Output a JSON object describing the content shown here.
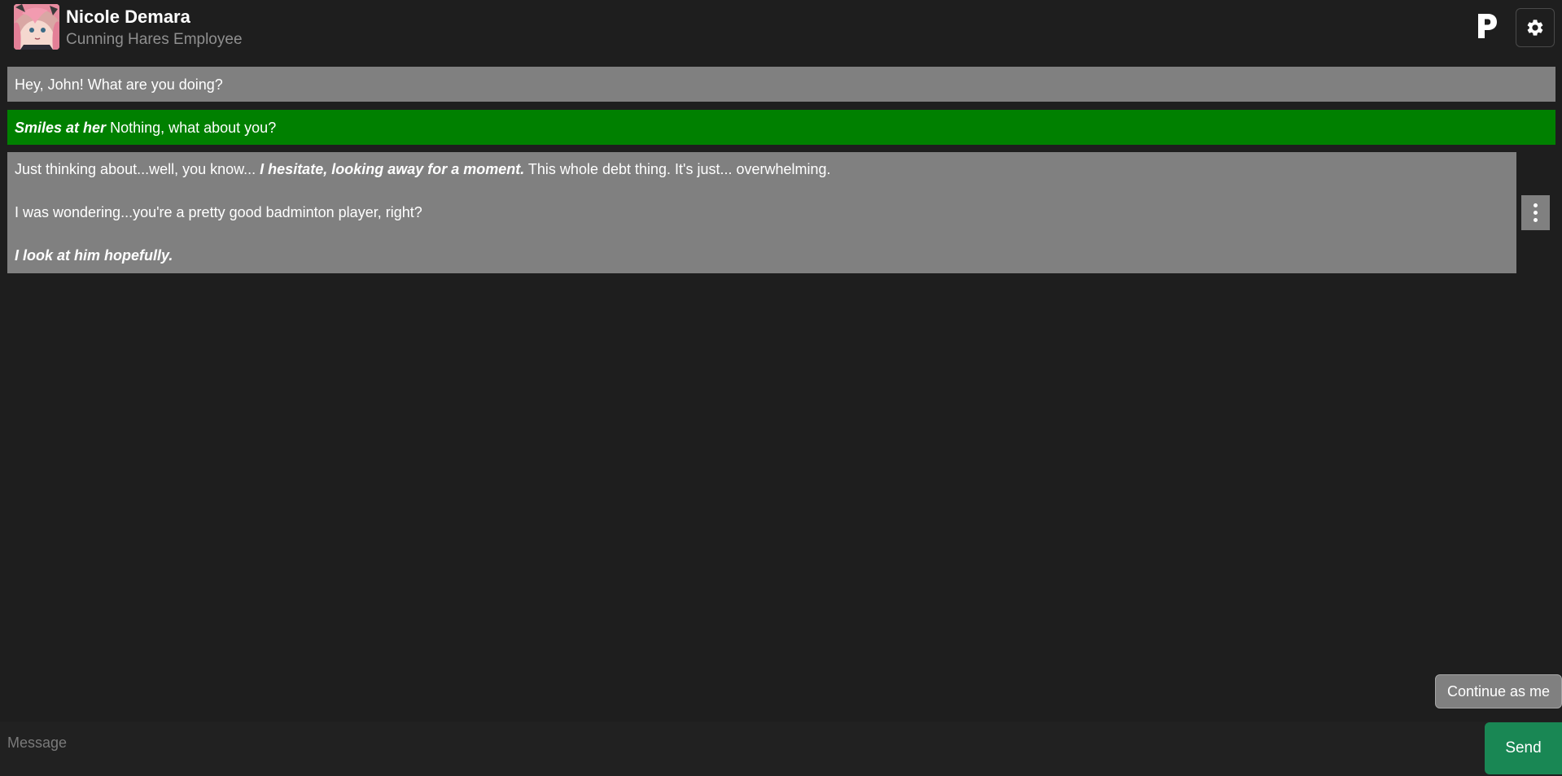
{
  "header": {
    "character_name": "Nicole Demara",
    "character_subtitle": "Cunning Hares Employee",
    "avatar_icon": "avatar-image",
    "logo_letter": "P",
    "settings_icon": "gear-icon"
  },
  "messages": [
    {
      "role": "character",
      "color": "#808080",
      "text": "Hey, John! What are you doing?"
    },
    {
      "role": "user",
      "color": "#008000",
      "action": "Smiles at her",
      "text": " Nothing, what about you?"
    },
    {
      "role": "character",
      "color": "#808080",
      "paragraphs": [
        {
          "text_before": "Just thinking about...well, you know... ",
          "action": "I hesitate, looking away for a moment.",
          "text_after": " This whole debt thing. It's just... overwhelming."
        },
        {
          "text": "I was wondering...you're a pretty good badminton player, right?"
        },
        {
          "action": "I look at him hopefully."
        }
      ],
      "menu_icon": "kebab-menu-icon"
    }
  ],
  "controls": {
    "continue_label": "Continue as me",
    "message_placeholder": "Message",
    "send_label": "Send"
  },
  "colors": {
    "background": "#1e1e1e",
    "character_bubble": "#808080",
    "user_bubble": "#008000",
    "send_button": "#198754"
  }
}
